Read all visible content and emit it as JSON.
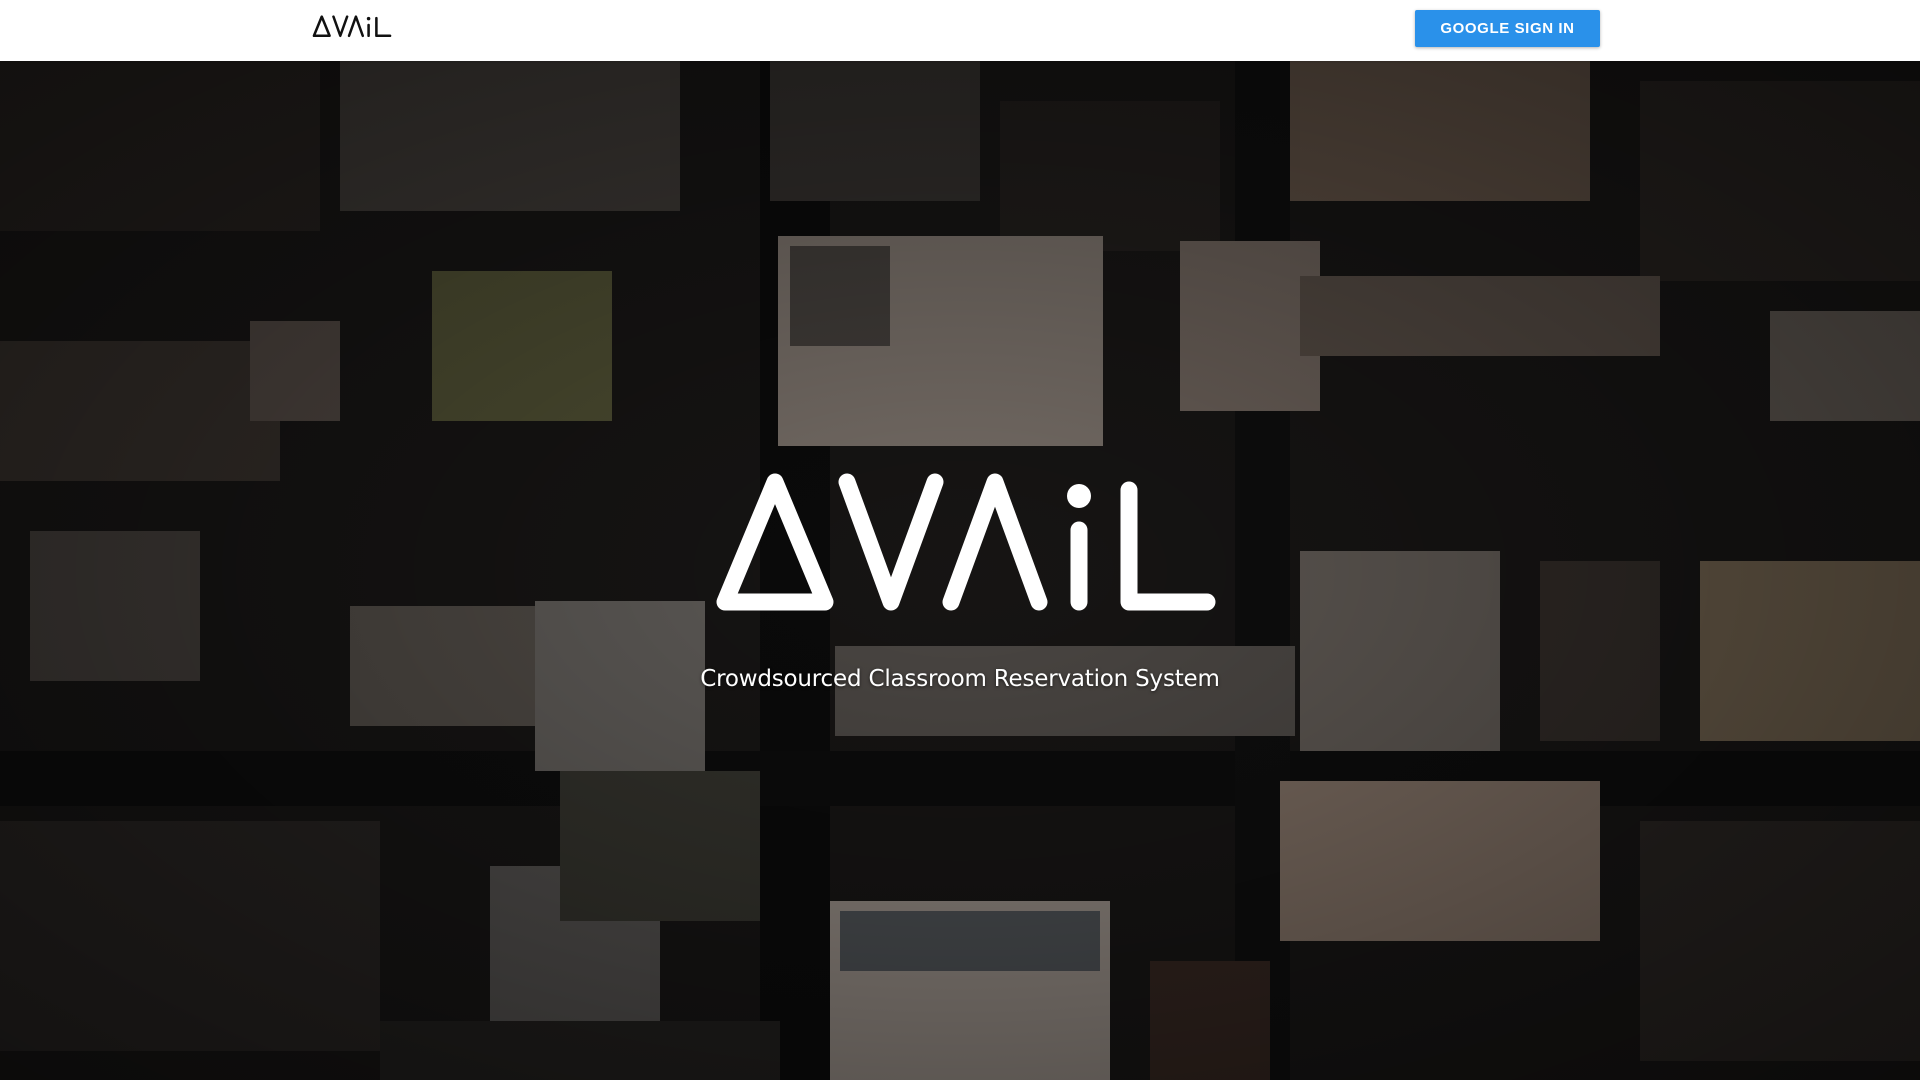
{
  "navbar": {
    "logo_text": "AVAiL",
    "signin_label": "GOOGLE SIGN IN"
  },
  "hero": {
    "logo_text": "AVAiL",
    "tagline": "Crowdsourced Classroom Reservation System",
    "background": "aerial-city-skyline-image"
  },
  "colors": {
    "navbar_bg": "#ffffff",
    "button_bg": "#2a91ea",
    "button_text": "#ffffff",
    "logo_dark": "#111111",
    "logo_light": "#ffffff"
  }
}
